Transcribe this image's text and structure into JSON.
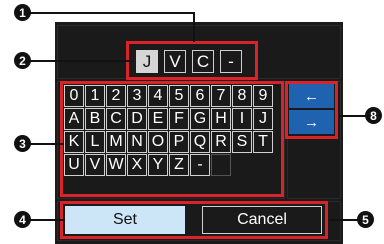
{
  "callouts": [
    "1",
    "2",
    "3",
    "4",
    "5",
    "8"
  ],
  "name_field": {
    "chars": [
      "J",
      "V",
      "C",
      "-"
    ],
    "selected_index": 0
  },
  "keyboard": {
    "rows": [
      [
        "0",
        "1",
        "2",
        "3",
        "4",
        "5",
        "6",
        "7",
        "8",
        "9"
      ],
      [
        "A",
        "B",
        "C",
        "D",
        "E",
        "F",
        "G",
        "H",
        "I",
        "J"
      ],
      [
        "K",
        "L",
        "M",
        "N",
        "O",
        "P",
        "Q",
        "R",
        "S",
        "T"
      ],
      [
        "U",
        "V",
        "W",
        "X",
        "Y",
        "Z",
        "-",
        ""
      ]
    ]
  },
  "cursor": {
    "left": "←",
    "right": "→"
  },
  "buttons": {
    "set": "Set",
    "cancel": "Cancel"
  },
  "colors": {
    "highlight": "#d8232a",
    "arrow_bg": "#1f63b0",
    "set_bg": "#cde6f7",
    "screen_bg": "#1a1a1a"
  }
}
